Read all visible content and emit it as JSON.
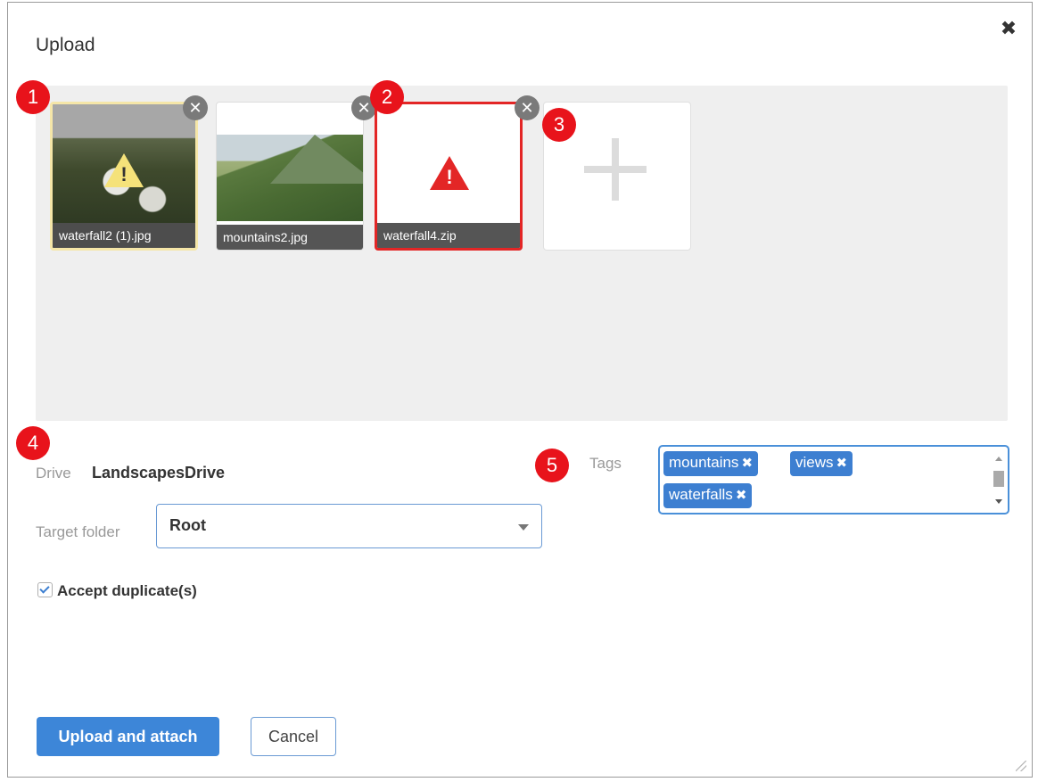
{
  "dialog": {
    "title": "Upload",
    "close_icon": "close-icon"
  },
  "files": [
    {
      "name": "waterfall2 (1).jpg",
      "status": "warning",
      "marker": "1"
    },
    {
      "name": "mountains2.jpg",
      "status": "ok"
    },
    {
      "name": "waterfall4.zip",
      "status": "error",
      "marker": "2"
    }
  ],
  "add_tile": {
    "icon": "plus-icon",
    "marker": "3"
  },
  "markers": {
    "m4": "4",
    "m5": "5"
  },
  "drive": {
    "label": "Drive",
    "value": "LandscapesDrive"
  },
  "target_folder": {
    "label": "Target folder",
    "value": "Root"
  },
  "tags": {
    "label": "Tags",
    "items": [
      "mountains",
      "views",
      "waterfalls"
    ],
    "remove_glyph": "✖"
  },
  "accept_duplicates": {
    "label": "Accept duplicate(s)",
    "checked": true
  },
  "buttons": {
    "primary": "Upload and attach",
    "cancel": "Cancel"
  },
  "colors": {
    "accent": "#3d86d8",
    "error": "#e32626",
    "warning": "#f5e27a",
    "marker": "#e8131b"
  }
}
